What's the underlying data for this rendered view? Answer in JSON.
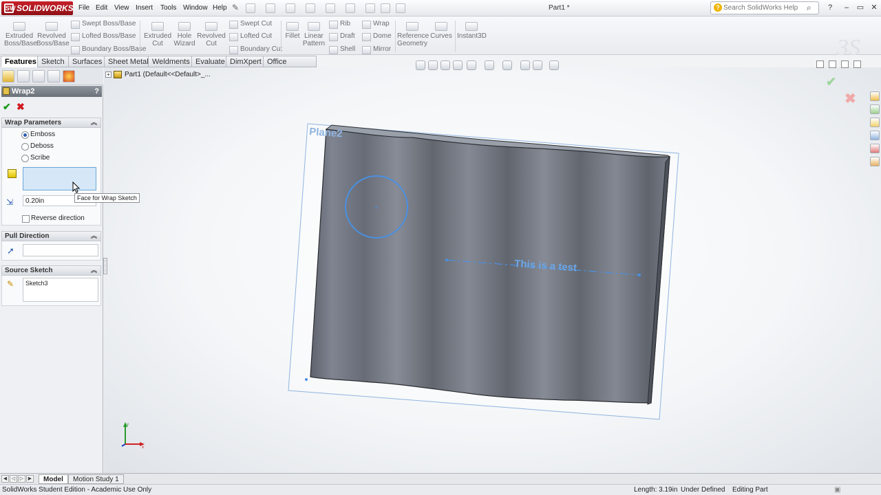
{
  "app": {
    "logo_text": "SOLIDWORKS",
    "logo_mark": "SW",
    "document_title": "Part1 *"
  },
  "menu": [
    "File",
    "Edit",
    "View",
    "Insert",
    "Tools",
    "Window",
    "Help"
  ],
  "help_search": {
    "placeholder": "Search SolidWorks Help",
    "icon_text": "?"
  },
  "command_manager": {
    "big_buttons": [
      {
        "label1": "Extruded",
        "label2": "Boss/Base"
      },
      {
        "label1": "Revolved",
        "label2": "Boss/Base"
      },
      {
        "label1": "Extruded",
        "label2": "Cut"
      },
      {
        "label1": "Hole",
        "label2": "Wizard"
      },
      {
        "label1": "Revolved",
        "label2": "Cut"
      },
      {
        "label1": "Fillet",
        "label2": ""
      },
      {
        "label1": "Linear",
        "label2": "Pattern"
      },
      {
        "label1": "Reference",
        "label2": "Geometry"
      },
      {
        "label1": "Curves",
        "label2": ""
      },
      {
        "label1": "Instant3D",
        "label2": ""
      }
    ],
    "small_buttons": [
      "Swept Boss/Base",
      "Lofted Boss/Base",
      "Boundary Boss/Base",
      "Swept Cut",
      "Lofted Cut",
      "Boundary Cut",
      "Rib",
      "Draft",
      "Shell",
      "Wrap",
      "Dome",
      "Mirror"
    ]
  },
  "cm_tabs": [
    "Features",
    "Sketch",
    "Surfaces",
    "Sheet Metal",
    "Weldments",
    "Evaluate",
    "DimXpert",
    "Office Products"
  ],
  "property_manager": {
    "title": "Wrap2",
    "help": "?",
    "ok": "✔",
    "cancel": "✖",
    "wrap_parameters": {
      "header": "Wrap Parameters",
      "options": [
        "Emboss",
        "Deboss",
        "Scribe"
      ],
      "selected": "Emboss",
      "thickness": "0.20in",
      "reverse_direction": "Reverse direction",
      "face_tooltip": "Face for Wrap Sketch"
    },
    "pull_direction": {
      "header": "Pull Direction"
    },
    "source_sketch": {
      "header": "Source Sketch",
      "value": "Sketch3"
    }
  },
  "tree": {
    "root_label": "Part1  (Default<<Default>_..."
  },
  "graphics": {
    "plane_label": "Plane2",
    "sketch_text": "This is a test"
  },
  "bottom_tabs": [
    "Model",
    "Motion Study 1"
  ],
  "status": {
    "edition": "SolidWorks Student Edition - Academic Use Only",
    "length": "Length: 3.19in",
    "definition": "Under Defined",
    "mode": "Editing Part"
  },
  "colors": {
    "brand_red": "#c8202a",
    "sketch_blue": "#4a90e2",
    "model_gray": "#6f7480"
  }
}
